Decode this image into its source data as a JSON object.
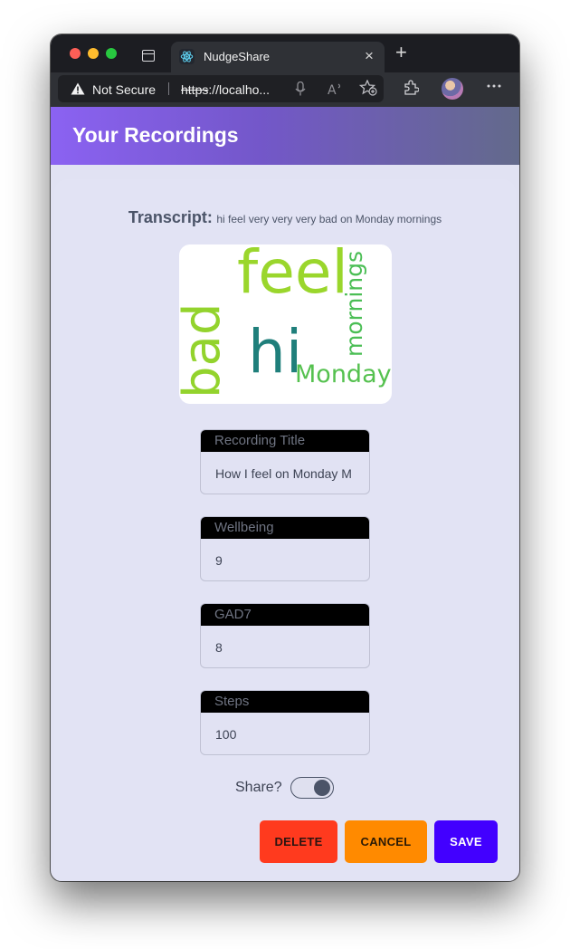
{
  "browser": {
    "tab_title": "NudgeShare",
    "tab_close": "×",
    "new_tab": "+",
    "security_label": "Not Secure",
    "url_scheme": "https",
    "url_rest": "://localho...",
    "icons": [
      "tabs-icon",
      "react-favicon-icon",
      "close-icon",
      "plus-icon",
      "warning-icon",
      "microphone-icon",
      "read-aloud-icon",
      "favorites-add-icon",
      "extensions-icon",
      "profile-avatar",
      "more-icon"
    ]
  },
  "header": {
    "title": "Your Recordings",
    "background": "#8b62f2"
  },
  "transcript": {
    "label": "Transcript:",
    "text": "hi feel very very very bad on Monday mornings"
  },
  "wordcloud": {
    "words": [
      {
        "text": "feel",
        "color": "#9ad62c"
      },
      {
        "text": "bad",
        "color": "#93d32d"
      },
      {
        "text": "hi",
        "color": "#1f7f7b"
      },
      {
        "text": "mornings",
        "color": "#4bbe55"
      },
      {
        "text": "Monday",
        "color": "#55c14f"
      }
    ]
  },
  "fields": [
    {
      "label": "Recording Title",
      "value": "How I feel on Monday M"
    },
    {
      "label": "Wellbeing",
      "value": "9"
    },
    {
      "label": "GAD7",
      "value": "8"
    },
    {
      "label": "Steps",
      "value": "100"
    }
  ],
  "share": {
    "label": "Share?",
    "on": true
  },
  "buttons": {
    "delete": "DELETE",
    "cancel": "CANCEL",
    "save": "SAVE"
  },
  "colors": {
    "delete": "#ff3a1e",
    "cancel": "#ff8a00",
    "save": "#4200ff",
    "page_bg": "#e1e2f3"
  }
}
